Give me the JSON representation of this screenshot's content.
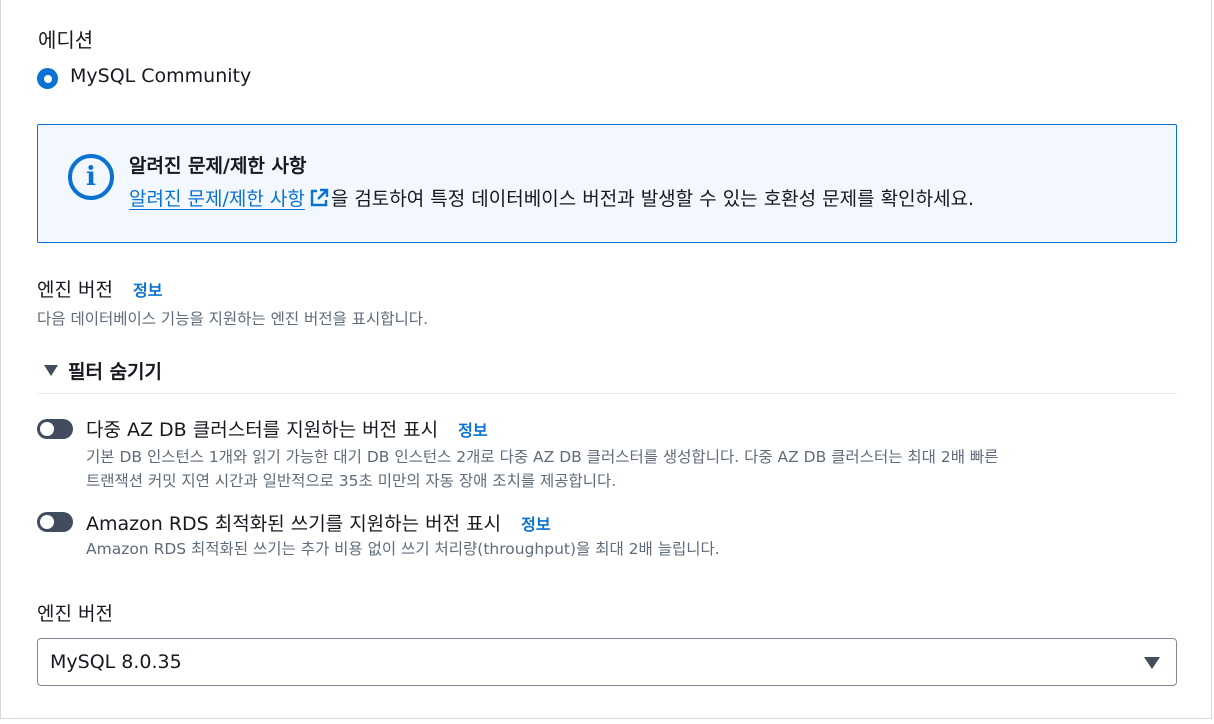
{
  "edition": {
    "label": "에디션",
    "option_label": "MySQL Community",
    "selected": true
  },
  "alert": {
    "title": "알려진 문제/제한 사항",
    "link_text": "알려진 문제/제한 사항",
    "text_suffix": "을 검토하여 특정 데이터베이스 버전과 발생할 수 있는 호환성 문제를 확인하세요.",
    "icon": "info-circle-icon"
  },
  "engine_version_section": {
    "label": "엔진 버전",
    "info": "정보",
    "description": "다음 데이터베이스 기능을 지원하는 엔진 버전을 표시합니다."
  },
  "filters": {
    "toggle_label": "필터 숨기기",
    "items": [
      {
        "label": "다중 AZ DB 클러스터를 지원하는 버전 표시",
        "info": "정보",
        "desc_line1": "기본 DB 인스턴스 1개와 읽기 가능한 대기 DB 인스턴스 2개로 다중 AZ DB 클러스터를 생성합니다. 다중 AZ DB 클러스터는 최대 2배 빠른",
        "desc_line2": "트랜잭션 커밋 지연 시간과 일반적으로 35초 미만의 자동 장애 조치를 제공합니다.",
        "enabled": false
      },
      {
        "label": "Amazon RDS 최적화된 쓰기를 지원하는 버전 표시",
        "info": "정보",
        "desc_line1": "Amazon RDS 최적화된 쓰기는 추가 비용 없이 쓰기 처리량(throughput)을 최대 2배 늘립니다.",
        "enabled": false
      }
    ]
  },
  "engine_version_select": {
    "label": "엔진 버전",
    "value": "MySQL 8.0.35"
  },
  "colors": {
    "link": "#0972d3",
    "alert_bg": "#f2f8fd",
    "toggle_off": "#414d5c"
  }
}
